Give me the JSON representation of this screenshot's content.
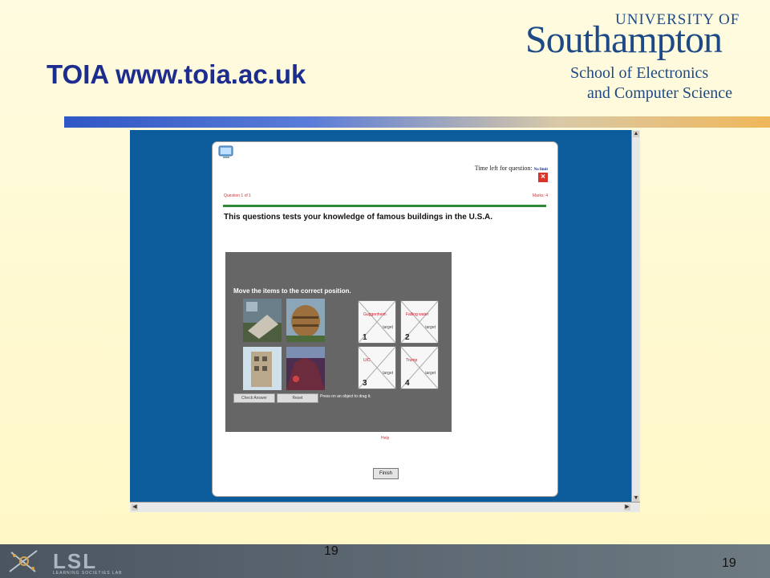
{
  "slide": {
    "title": "TOIA www.toia.ac.uk",
    "page_number_center": "19",
    "page_number_right": "19"
  },
  "logo": {
    "line1": "UNIVERSITY OF",
    "line2": "Southampton",
    "line3": "School of Electronics",
    "line4": "and Computer Science"
  },
  "footer": {
    "brand": "LSL",
    "subtitle": "LEARNING SOCIETIES LAB"
  },
  "quiz": {
    "timer_label": "Time left for question:",
    "timer_value": "No limit",
    "question_counter": "Question 1 of 1",
    "marks": "Marks: 4",
    "question_text": "This questions tests your knowledge of famous buildings in the U.S.A.",
    "instruction": "Move the items to the correct position.",
    "targets": [
      {
        "label": "Guggenheim",
        "target_word": "target",
        "number": "1"
      },
      {
        "label": "Falling water",
        "target_word": "target",
        "number": "2"
      },
      {
        "label": "UIC",
        "target_word": "target",
        "number": "3"
      },
      {
        "label": "Trump",
        "target_word": "target",
        "number": "4"
      }
    ],
    "check_answer_label": "Check Answer",
    "reset_label": "Reset",
    "drag_hint": "Press on an object to drag it.",
    "help_label": "Help",
    "finish_label": "Finish"
  },
  "colors": {
    "title": "#1c2d8f",
    "screenshot_bg": "#0c5b9a",
    "accent_green": "#2f8a35",
    "accent_red": "#cc3333"
  }
}
